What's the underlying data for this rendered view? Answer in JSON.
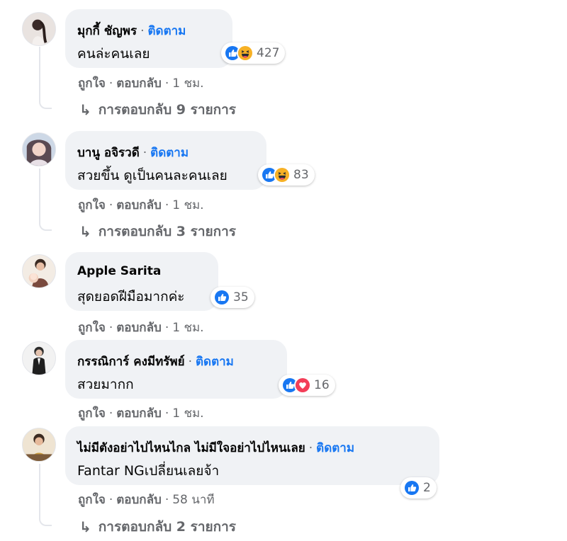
{
  "comments": [
    {
      "author": "มุกกี้ ชัญพร",
      "follow": "ติดตาม",
      "text": "คนล่ะคนเลย",
      "reaction_icons": [
        "like-icon",
        "haha-icon"
      ],
      "reaction_count": "427",
      "like": "ถูกใจ",
      "reply": "ตอบกลับ",
      "time": "1 ชม.",
      "replies": "การตอบกลับ 9 รายการ"
    },
    {
      "author": "บานู อจิรวดี",
      "follow": "ติดตาม",
      "text": "สวยขึ้น ดูเป็นคนละคนเลย",
      "reaction_icons": [
        "like-icon",
        "haha-icon"
      ],
      "reaction_count": "83",
      "like": "ถูกใจ",
      "reply": "ตอบกลับ",
      "time": "1 ชม.",
      "replies": "การตอบกลับ 3 รายการ"
    },
    {
      "author": "Apple Sarita",
      "follow": "",
      "text": "สุดยอดฝีมือมากค่ะ",
      "reaction_icons": [
        "like-icon"
      ],
      "reaction_count": "35",
      "like": "ถูกใจ",
      "reply": "ตอบกลับ",
      "time": "1 ชม.",
      "replies": ""
    },
    {
      "author": "กรรณิการ์ คงมีทรัพย์",
      "follow": "ติดตาม",
      "text": "สวยมากก",
      "reaction_icons": [
        "like-icon",
        "love-icon"
      ],
      "reaction_count": "16",
      "like": "ถูกใจ",
      "reply": "ตอบกลับ",
      "time": "1 ชม.",
      "replies": ""
    },
    {
      "author": "ไม่มีตังอย่าไปไหนไกล ไม่มีใจอย่าไปไหนเลย",
      "follow": "ติดตาม",
      "text": "Fantar NGเปลี่ยนเลยจ้า",
      "reaction_icons": [
        "like-icon"
      ],
      "reaction_count": "2",
      "like": "ถูกใจ",
      "reply": "ตอบกลับ",
      "time": "58 นาที",
      "replies": "การตอบกลับ 2 รายการ"
    }
  ],
  "colors": {
    "bubble": "#f0f2f5",
    "follow": "#1877f2",
    "meta": "#65676b",
    "like": "#1877f2",
    "haha": "#f7b125",
    "love": "#f33e58"
  }
}
